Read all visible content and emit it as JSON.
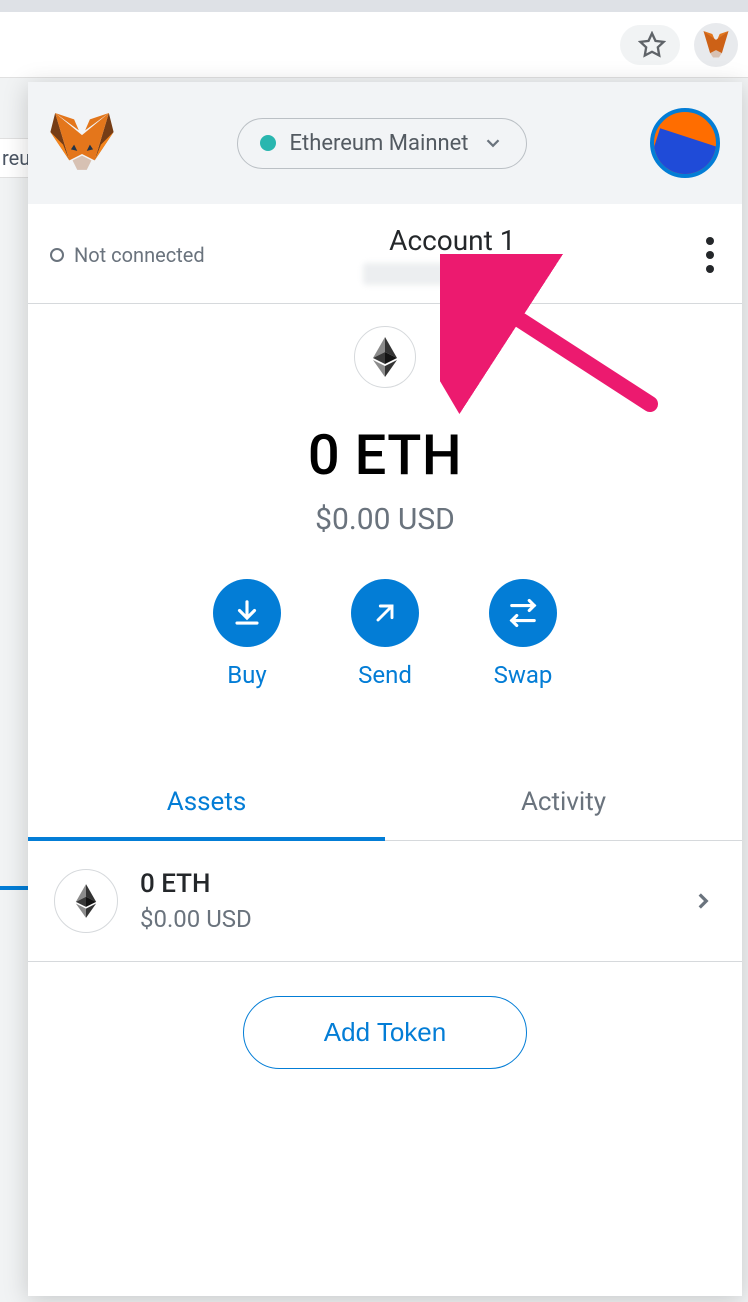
{
  "browser": {
    "page_fragment": "reu"
  },
  "header": {
    "network": "Ethereum Mainnet"
  },
  "account": {
    "connection_status": "Not connected",
    "name": "Account 1"
  },
  "balance": {
    "primary": "0 ETH",
    "secondary": "$0.00 USD"
  },
  "actions": {
    "buy": "Buy",
    "send": "Send",
    "swap": "Swap"
  },
  "tabs": {
    "assets": "Assets",
    "activity": "Activity"
  },
  "assets": [
    {
      "amount": "0 ETH",
      "fiat": "$0.00 USD"
    }
  ],
  "add_token_label": "Add Token",
  "colors": {
    "primary": "#037dd6",
    "network_dot": "#29b6af",
    "annotation": "#ec1a6f"
  }
}
